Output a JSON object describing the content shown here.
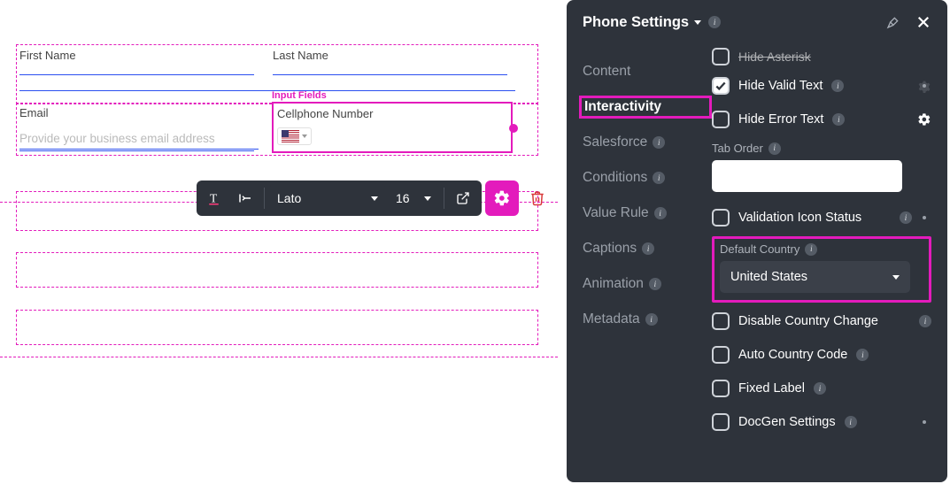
{
  "canvas": {
    "fields": {
      "first_name_label": "First Name",
      "last_name_label": "Last Name",
      "email_label": "Email",
      "email_placeholder": "Provide your business email address",
      "cellphone_label": "Cellphone Number"
    },
    "selected_tag": "Input Fields"
  },
  "toolbar": {
    "font_family": "Lato",
    "font_size": "16"
  },
  "panel": {
    "title": "Phone Settings",
    "tabs": {
      "content": "Content",
      "interactivity": "Interactivity",
      "salesforce": "Salesforce",
      "conditions": "Conditions",
      "value_rule": "Value Rule",
      "captions": "Captions",
      "animation": "Animation",
      "metadata": "Metadata"
    },
    "props": {
      "hide_asterisk": "Hide Asterisk",
      "hide_valid_text": "Hide Valid Text",
      "hide_error_text": "Hide Error Text",
      "tab_order": "Tab Order",
      "validation_icon_status": "Validation Icon Status",
      "default_country": "Default Country",
      "default_country_value": "United States",
      "disable_country_change": "Disable Country Change",
      "auto_country_code": "Auto Country Code",
      "fixed_label": "Fixed Label",
      "docgen_settings": "DocGen Settings"
    }
  }
}
